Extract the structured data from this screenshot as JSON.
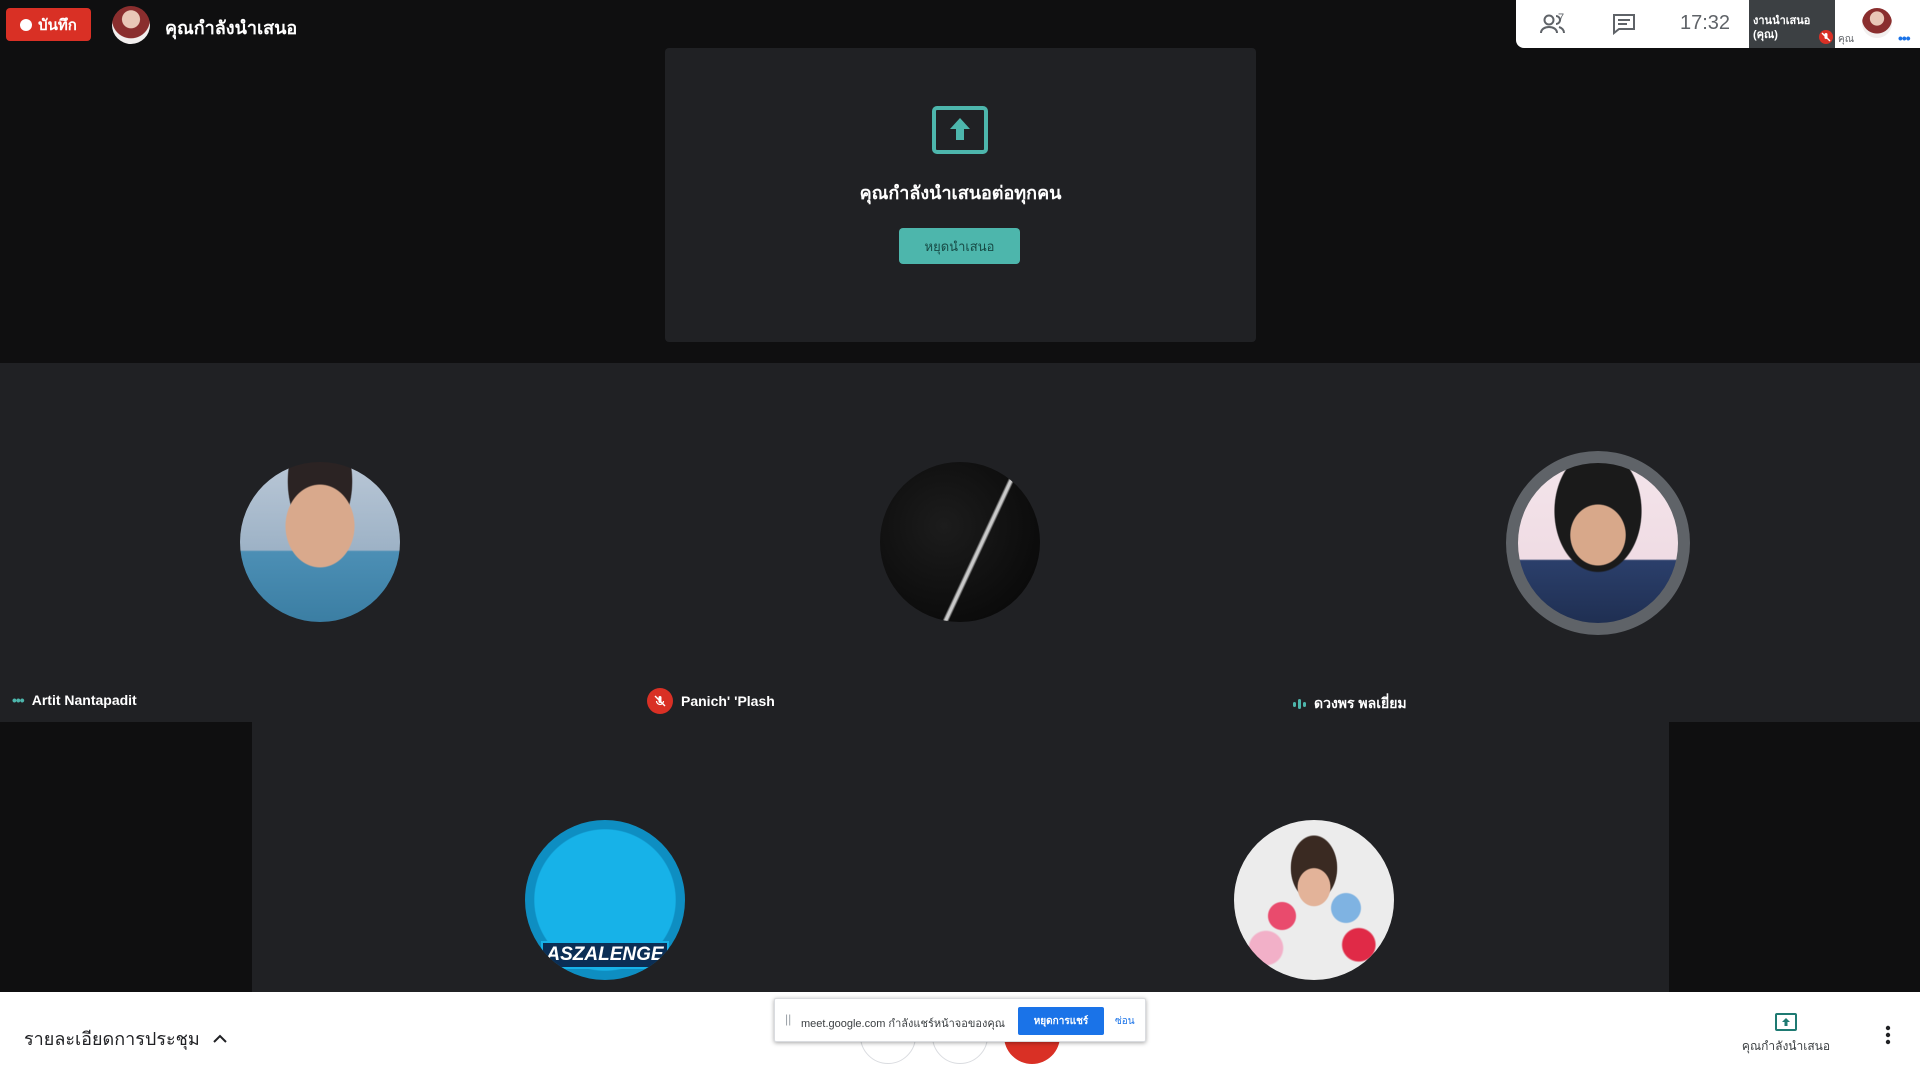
{
  "top_bar": {
    "record_label": "บันทึก",
    "presenter_title": "คุณกำลังนำเสนอ",
    "people_count": "7",
    "clock": "17:32",
    "self_tile_label": "งานนำเสนอ (คุณ)",
    "self_label": "คุณ"
  },
  "presentation": {
    "message": "คุณกำลังนำเสนอต่อทุกคน",
    "stop_button": "หยุดนำเสนอ"
  },
  "participants": [
    {
      "name": "Artit Nantapadit",
      "status": "more-options"
    },
    {
      "name": "Panich' 'Plash",
      "status": "muted"
    },
    {
      "name": "ดวงพร พลเยี่ยม",
      "status": "speaking"
    },
    {
      "name": "",
      "avatar_text": "ASZALENGE"
    },
    {
      "name": ""
    }
  ],
  "bottom_bar": {
    "meeting_details": "รายละเอียดการประชุม",
    "present_now_label": "คุณกำลังนำเสนอ"
  },
  "share_banner": {
    "text": "meet.google.com กำลังแชร์หน้าจอของคุณ",
    "stop_button": "หยุดการแชร์",
    "hide_link": "ซ่อน"
  },
  "colors": {
    "accent_teal": "#4db6ac",
    "record_red": "#d93025",
    "tile_bg": "#202124",
    "share_blue": "#1a73e8"
  }
}
